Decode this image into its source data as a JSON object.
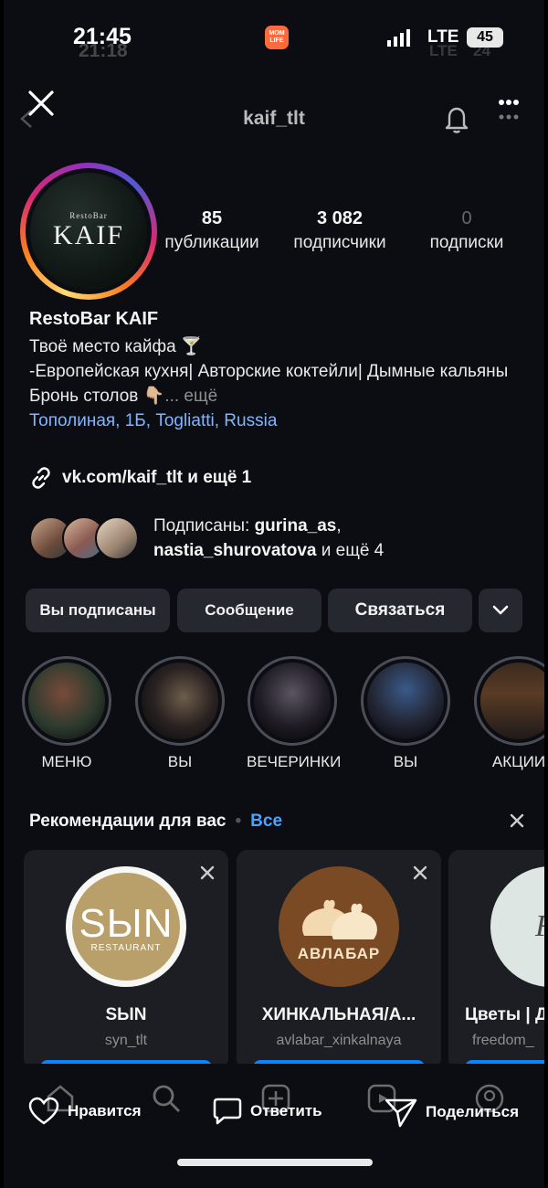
{
  "status_bar": {
    "time": "21:45",
    "time_ghost": "21:18",
    "app_badge": "MOM LIFE",
    "network": "LTE",
    "battery": "45",
    "network_ghost": "LTE",
    "battery_ghost": "24"
  },
  "header": {
    "username": "kaif_tlt"
  },
  "profile": {
    "avatar_small_text": "RestoBar",
    "avatar_big_text": "KAIF",
    "stats": [
      {
        "value": "85",
        "label": "публикации"
      },
      {
        "value": "3 082",
        "label": "подписчики"
      },
      {
        "value": "0",
        "label": "подписки"
      }
    ],
    "name": "RestoBar KAIF",
    "bio_line1": "Твоё место кайфа 🍸",
    "bio_line2": "-Европейская кухня| Авторские коктейли| Дымные кальяны",
    "bio_line3": "Бронь столов 👇🏼",
    "bio_more": "... ещё",
    "location": "Тополиная, 1Б, Togliatti, Russia",
    "link": "vk.com/kaif_tlt и ещё 1",
    "followed_prefix": "Подписаны: ",
    "followed_user1": "gurina_as",
    "followed_sep": ",",
    "followed_user2": "nastia_shurovatova",
    "followed_suffix": " и ещё 4"
  },
  "buttons": {
    "subscribed": "Вы подписаны",
    "message": "Сообщение",
    "contact": "Связаться"
  },
  "highlights": [
    {
      "label": "МЕНЮ"
    },
    {
      "label": "ВЫ"
    },
    {
      "label": "ВЕЧЕРИНКИ"
    },
    {
      "label": "ВЫ"
    },
    {
      "label": "АКЦИИ"
    }
  ],
  "recommendations": {
    "title": "Рекомендации для вас",
    "separator": "•",
    "all": "Все",
    "cards": [
      {
        "name": "SЫN",
        "handle": "syn_tlt",
        "logo_main": "SЫN",
        "logo_sub": "RESTAURANT"
      },
      {
        "name": "ХИНКАЛЬНАЯ/А...",
        "handle": "avlabar_xinkalnaya",
        "logo_main": "АВЛАБАР"
      },
      {
        "name": "Цветы | Д",
        "handle": "freedom_",
        "logo_main": "Fr"
      }
    ]
  },
  "actions": {
    "like": "Нравится",
    "reply": "Ответить",
    "share": "Поделиться"
  },
  "colors": {
    "background": "#0b0d12",
    "button_bg": "#262830",
    "link_blue": "#7fb6ff",
    "accent_blue": "#4aa3ff",
    "follow_blue": "#0a84ff"
  }
}
